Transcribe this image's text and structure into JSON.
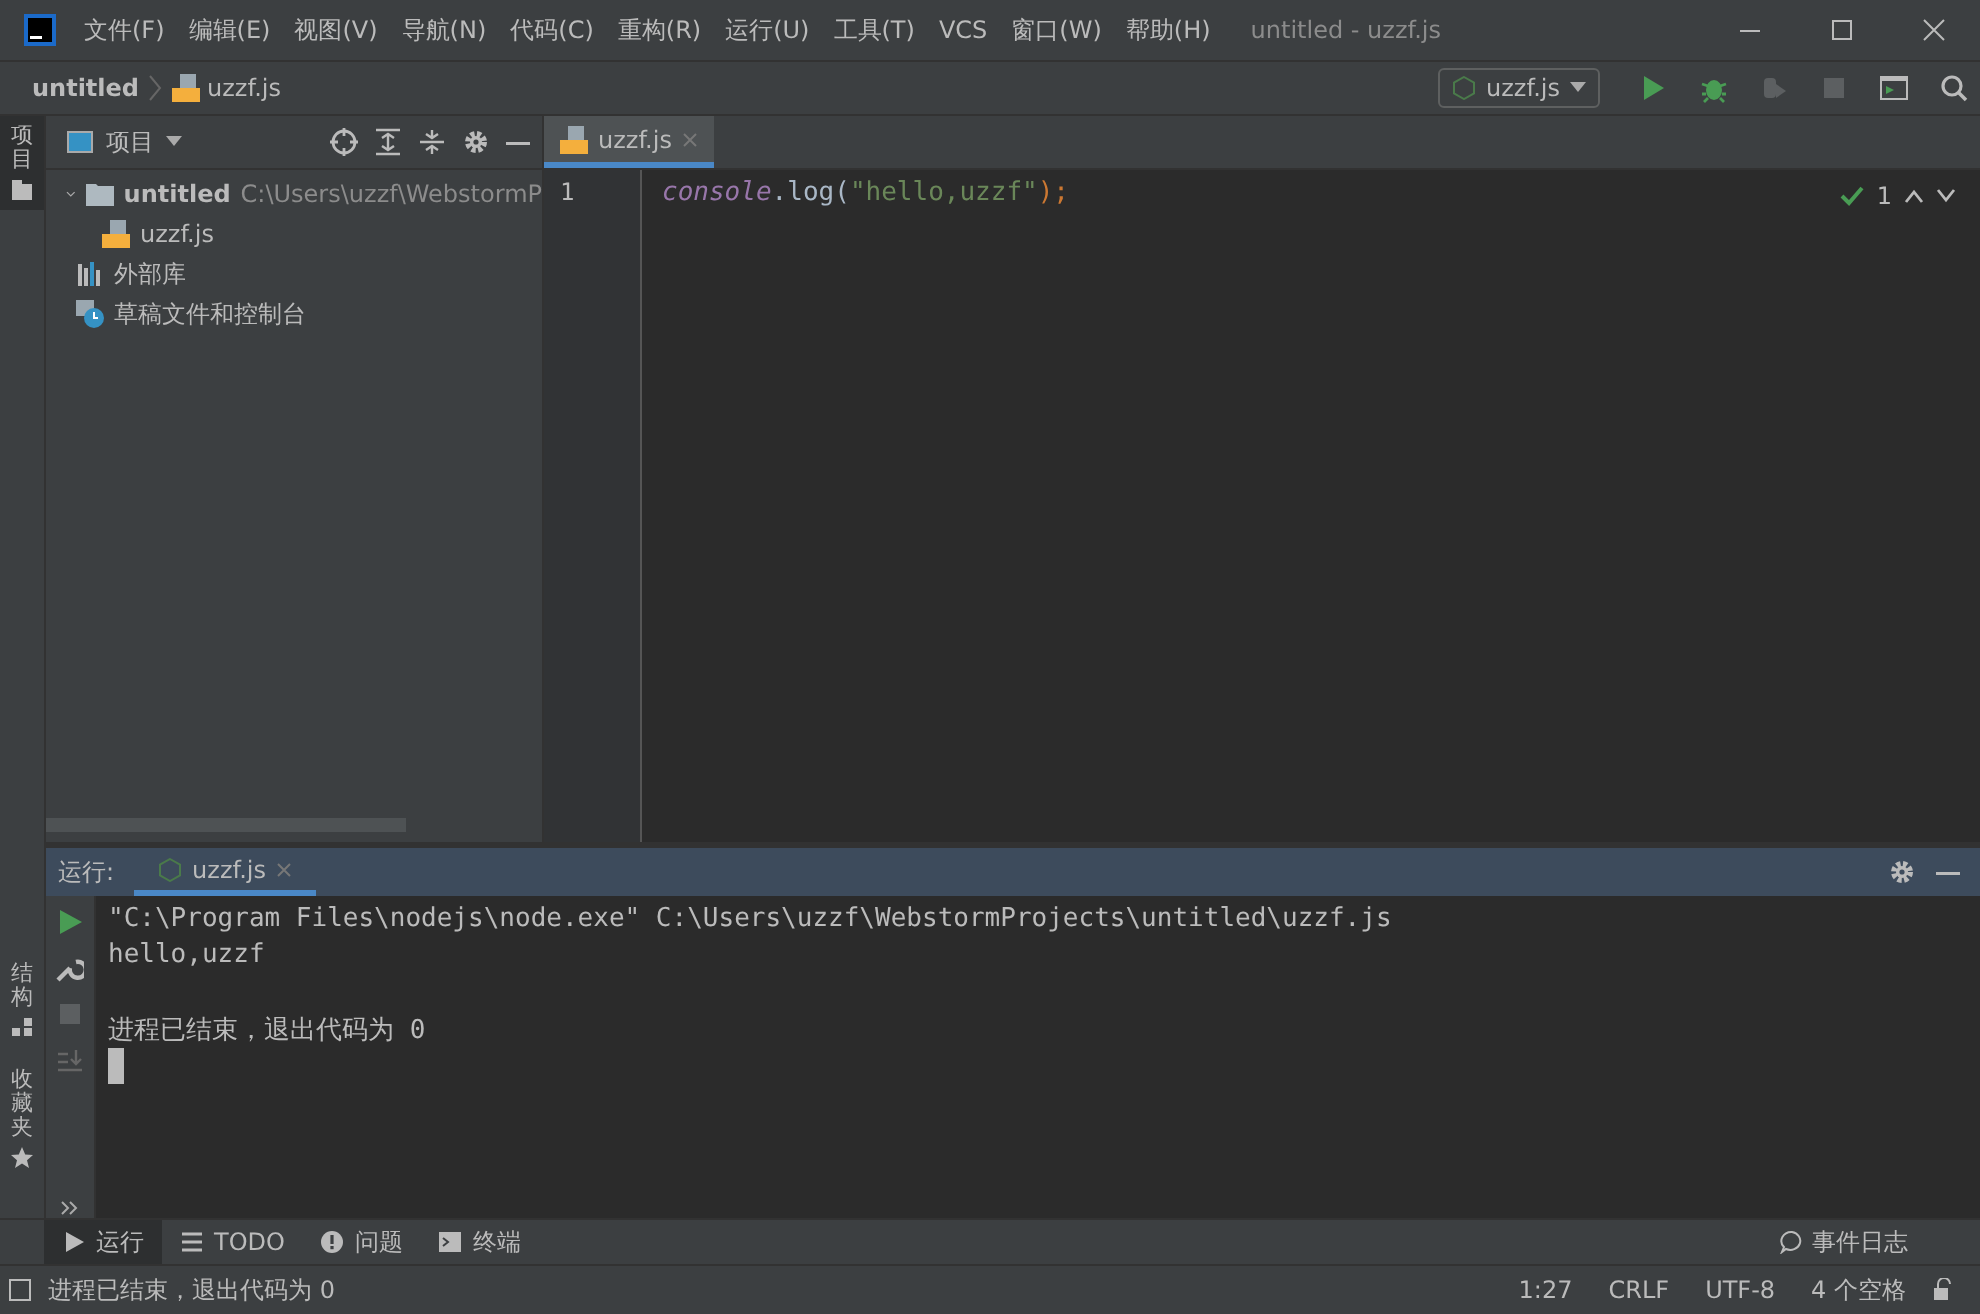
{
  "window": {
    "title": "untitled - uzzf.js"
  },
  "menu": [
    "文件(F)",
    "编辑(E)",
    "视图(V)",
    "导航(N)",
    "代码(C)",
    "重构(R)",
    "运行(U)",
    "工具(T)",
    "VCS",
    "窗口(W)",
    "帮助(H)"
  ],
  "breadcrumb": [
    "untitled",
    "uzzf.js"
  ],
  "run_config": {
    "label": "uzzf.js"
  },
  "side_tabs": [
    {
      "label": "项目",
      "selected": true,
      "kind": "project"
    },
    {
      "label": "结构",
      "selected": false,
      "kind": "structure"
    },
    {
      "label": "收藏夹",
      "selected": false,
      "kind": "favorites"
    }
  ],
  "project_panel": {
    "title": "项目",
    "tree": [
      {
        "label": "untitled",
        "path": "C:\\Users\\uzzf\\WebstormP",
        "kind": "folder",
        "expanded": true,
        "children": [
          {
            "label": "uzzf.js",
            "kind": "js"
          }
        ]
      },
      {
        "label": "外部库",
        "kind": "library"
      },
      {
        "label": "草稿文件和控制台",
        "kind": "scratch"
      }
    ]
  },
  "editor": {
    "tabs": [
      {
        "label": "uzzf.js",
        "selected": true
      }
    ],
    "lines": [
      {
        "number": "1",
        "tokens": [
          {
            "text": "console",
            "kind": "global"
          },
          {
            "text": ".log(",
            "kind": "plain"
          },
          {
            "text": "\"hello,uzzf\"",
            "kind": "string"
          },
          {
            "text": ");",
            "kind": "punct"
          }
        ]
      }
    ],
    "inspection": "1"
  },
  "run_panel": {
    "label": "运行:",
    "tabs": [
      {
        "label": "uzzf.js",
        "selected": true
      }
    ],
    "output": [
      {
        "text": "\"C:\\Program Files\\nodejs\\node.exe\" C:\\Users\\uzzf\\WebstormProjects\\untitled\\uzzf.js",
        "kind": "command"
      },
      {
        "text": "hello,uzzf",
        "kind": "stdout"
      },
      {
        "text": "进程已结束，退出代码为 0",
        "kind": "exit"
      }
    ]
  },
  "tool_windows": [
    {
      "label": "运行",
      "kind": "run",
      "selected": true
    },
    {
      "label": "TODO",
      "kind": "todo",
      "selected": false
    },
    {
      "label": "问题",
      "kind": "problems",
      "selected": false
    },
    {
      "label": "终端",
      "kind": "terminal",
      "selected": false
    }
  ],
  "event_log": "事件日志",
  "status_bar": {
    "message": "进程已结束，退出代码为 0",
    "items": [
      "1:27",
      "CRLF",
      "UTF-8",
      "4 个空格"
    ]
  }
}
